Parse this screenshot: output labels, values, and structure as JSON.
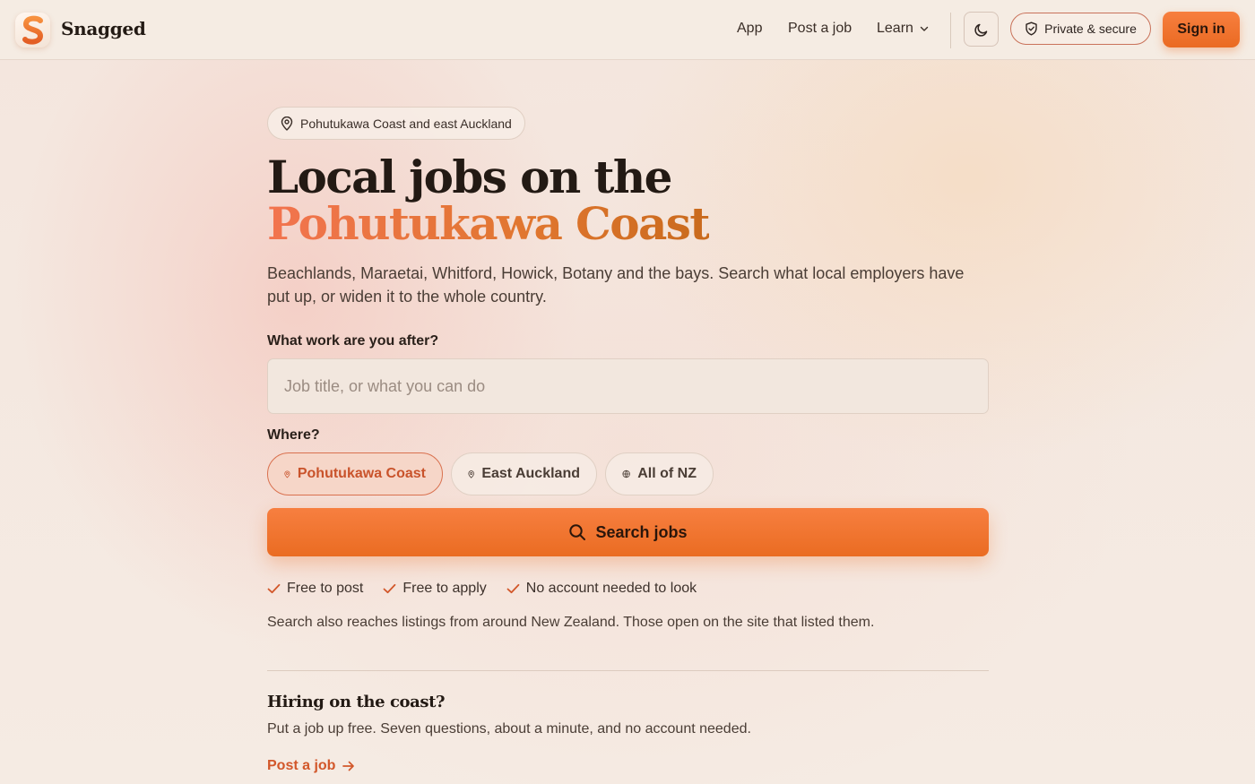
{
  "header": {
    "brand": "Snagged",
    "logo_letter": "S",
    "nav": {
      "app": "App",
      "post_job": "Post a job",
      "learn": "Learn"
    },
    "secure_label": "Private & secure",
    "sign_in": "Sign in"
  },
  "hero": {
    "location_chip": "Pohutukawa Coast and east Auckland",
    "headline_line1": "Local jobs on the",
    "headline_line2": "Pohutukawa Coast",
    "subtitle": "Beachlands, Maraetai, Whitford, Howick, Botany and the bays. Search what local employers have put up, or widen it to the whole country."
  },
  "search": {
    "what_label": "What work are you after?",
    "what_placeholder": "Job title, or what you can do",
    "what_value": "",
    "where_label": "Where?",
    "where_options": [
      "Pohutukawa Coast",
      "East Auckland",
      "All of NZ"
    ],
    "where_selected": "Pohutukawa Coast",
    "button_label": "Search jobs"
  },
  "perks": [
    "Free to post",
    "Free to apply",
    "No account needed to look"
  ],
  "reach_note": "Search also reaches listings from around New Zealand. Those open on the site that listed them.",
  "hiring": {
    "title": "Hiring on the coast?",
    "text": "Put a job up free. Seven questions, about a minute, and no account needed.",
    "link": "Post a job"
  },
  "icons": {
    "logo": "snagged-logo-icon",
    "learn_chevron": "chevron-down-icon",
    "theme": "moon-icon",
    "secure": "shield-check-icon",
    "location": "map-pin-icon",
    "globe": "globe-icon",
    "search": "search-icon",
    "check": "check-icon",
    "arrow": "arrow-right-icon"
  },
  "colors": {
    "accent": "#ea6c22",
    "accent_text": "#d2572a",
    "selected_chip_bg": "#f6d6c8",
    "background": "#f5ece4"
  }
}
